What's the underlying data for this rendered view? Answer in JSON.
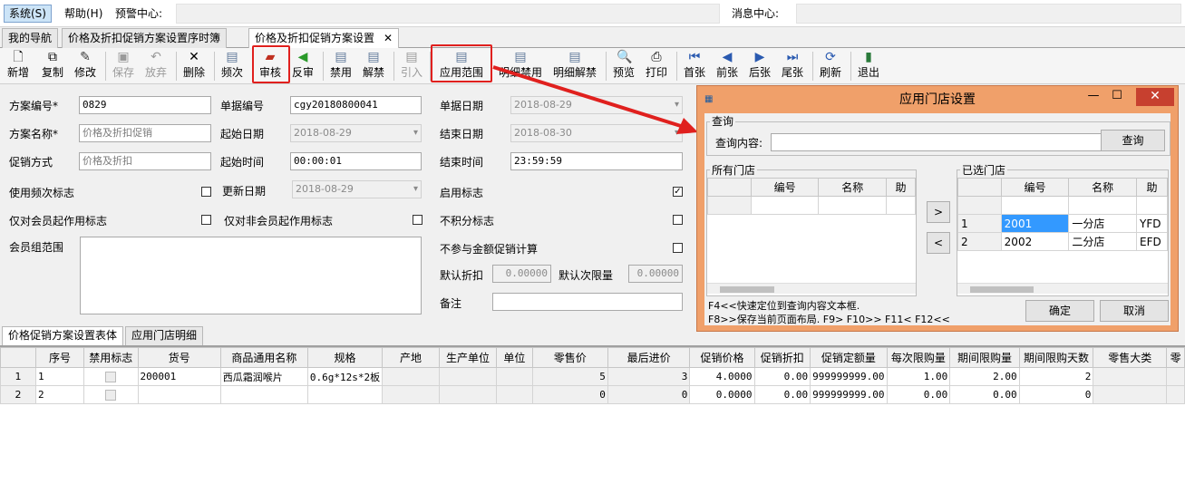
{
  "menubar": {
    "system": "系统(S)",
    "help": "帮助(H)",
    "alert_center": "预警中心:",
    "message_center": "消息中心:"
  },
  "tabs": [
    {
      "label": "我的导航"
    },
    {
      "label": "价格及折扣促销方案设置序时簿"
    },
    {
      "label": "价格及折扣促销方案设置",
      "close": "✕"
    }
  ],
  "toolbar": {
    "new": "新增",
    "copy": "复制",
    "modify": "修改",
    "save": "保存",
    "discard": "放弃",
    "delete": "删除",
    "frequency": "频次",
    "audit": "审核",
    "unaudit": "反审",
    "ban": "禁用",
    "unban": "解禁",
    "import": "引入",
    "apply_scope": "应用范围",
    "detail_ban": "明细禁用",
    "detail_unban": "明细解禁",
    "preview": "预览",
    "print": "打印",
    "first": "首张",
    "prev": "前张",
    "next": "后张",
    "last": "尾张",
    "refresh": "刷新",
    "exit": "退出"
  },
  "form": {
    "plan_no_label": "方案编号*",
    "plan_no": "0829",
    "bill_no_label": "单据编号",
    "bill_no": "cgy20180800041",
    "bill_date_label": "单据日期",
    "bill_date": "2018-08-29",
    "plan_name_label": "方案名称*",
    "plan_name": "价格及折扣促销",
    "start_date_label": "起始日期",
    "start_date": "2018-08-29",
    "end_date_label": "结束日期",
    "end_date": "2018-08-30",
    "promo_mode_label": "促销方式",
    "promo_mode": "价格及折扣",
    "start_time_label": "起始时间",
    "start_time": "00:00:01",
    "end_time_label": "结束时间",
    "end_time": "23:59:59",
    "use_freq_label": "使用频次标志",
    "update_date_label": "更新日期",
    "update_date": "2018-08-29",
    "enable_label": "启用标志",
    "member_only_label": "仅对会员起作用标志",
    "nonmember_only_label": "仅对非会员起作用标志",
    "no_points_label": "不积分标志",
    "member_group_label": "会员组范围",
    "no_amount_promo_label": "不参与金额促销计算",
    "default_discount_label": "默认折扣",
    "default_discount": "0.00000",
    "default_limit_label": "默认次限量",
    "default_limit": "0.00000",
    "remark_label": "备注"
  },
  "lower_tabs": [
    {
      "label": "价格促销方案设置表体"
    },
    {
      "label": "应用门店明细"
    }
  ],
  "grid": {
    "headers": [
      "序号",
      "禁用标志",
      "货号",
      "商品通用名称",
      "规格",
      "产地",
      "生产单位",
      "单位",
      "零售价",
      "最后进价",
      "促销价格",
      "促销折扣",
      "促销定额量",
      "每次限购量",
      "期间限购量",
      "期间限购天数",
      "零售大类",
      "零"
    ],
    "rows": [
      {
        "rownum": "1",
        "cells": [
          "1",
          "",
          "200001",
          "西瓜霜润喉片",
          "0.6g*12s*2板",
          "",
          "",
          "",
          "5",
          "3",
          "4.0000",
          "0.00",
          "999999999.00",
          "1.00",
          "2.00",
          "2",
          "",
          ""
        ]
      },
      {
        "rownum": "2",
        "cells": [
          "2",
          "",
          "",
          "",
          "",
          "",
          "",
          "",
          "0",
          "0",
          "0.0000",
          "0.00",
          "999999999.00",
          "0.00",
          "0.00",
          "0",
          "",
          ""
        ]
      }
    ]
  },
  "dialog": {
    "title": "应用门店设置",
    "query_group": "查询",
    "query_label": "查询内容:",
    "query_value": "",
    "query_button": "查询",
    "all_stores": "所有门店",
    "all_headers": [
      "编号",
      "名称",
      "助"
    ],
    "selected_stores": "已选门店",
    "sel_headers": [
      "编号",
      "名称",
      "助"
    ],
    "add_button": ">",
    "remove_button": "<",
    "selected_rows": [
      {
        "n": "1",
        "code": "2001",
        "name": "一分店",
        "abbr": "YFD"
      },
      {
        "n": "2",
        "code": "2002",
        "name": "二分店",
        "abbr": "EFD"
      }
    ],
    "hint1": "F4<<快速定位到查询内容文本框.",
    "hint2": "F8>>保存当前页面布局. F9> F10>> F11< F12<<",
    "ok": "确定",
    "cancel": "取消"
  },
  "colors": {
    "highlight_red": "#e0201e",
    "dialog_frame": "#f0a06a",
    "selection_blue": "#3399ff"
  }
}
